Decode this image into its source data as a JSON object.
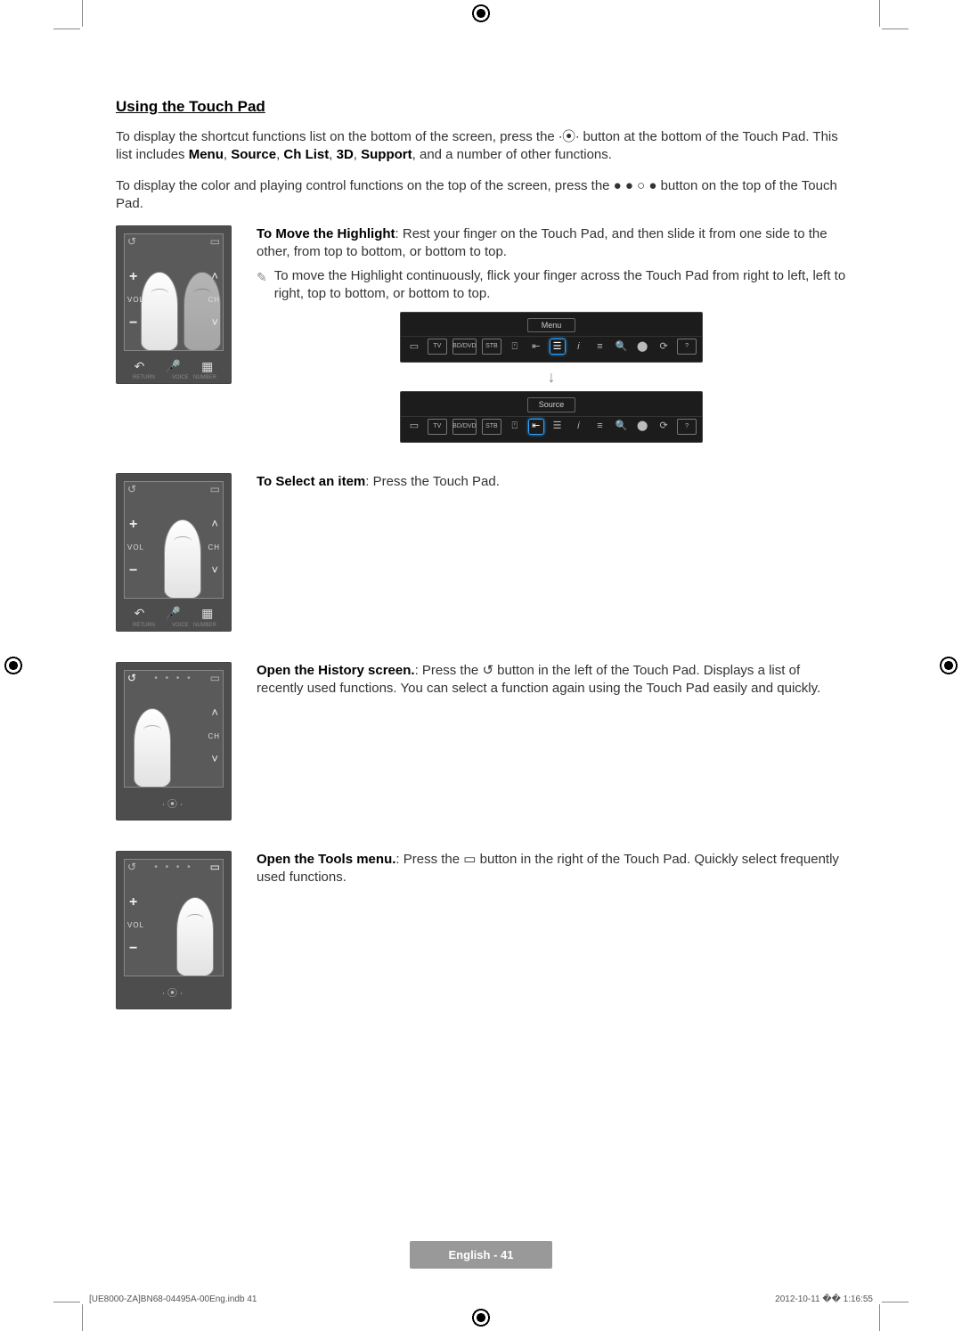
{
  "heading": "Using the Touch Pad",
  "intro1_a": "To display the shortcut functions list on the bottom of the screen, press the ",
  "intro1_b": " button at the bottom of the Touch Pad. This list includes ",
  "intro1_words": {
    "menu": "Menu",
    "source": "Source",
    "chlist": "Ch List",
    "threeD": "3D",
    "support": "Support"
  },
  "intro1_c": ", and a number of other functions.",
  "intro2_a": "To display the color and playing control functions on the top of the screen, press the ",
  "intro2_b": " button on the top of the Touch Pad.",
  "move": {
    "title": "To Move the Highlight",
    "body": ": Rest your finger on the Touch Pad, and then slide it from one side to the other, from top to bottom, or bottom to top.",
    "note": "To move the Highlight continuously, flick your finger across the Touch Pad from right to left, left to right, top to bottom, or bottom to top."
  },
  "menubar": {
    "label": "Menu"
  },
  "sourcebar": {
    "label": "Source"
  },
  "baricons": {
    "tv": "TV",
    "bddvd": "BD/DVD",
    "stb": "STB"
  },
  "select": {
    "title": "To Select an item",
    "body": ": Press the Touch Pad."
  },
  "history": {
    "title": "Open the History screen.",
    "body1": ": Press the ",
    "body2": " button in the left of the Touch Pad. Displays a list of recently used functions. You can select a function again using the Touch Pad easily and quickly."
  },
  "tools": {
    "title": "Open the Tools menu.",
    "body1": ": Press the ",
    "body2": " button in the right of the Touch Pad. Quickly select frequently used functions."
  },
  "touchpad_labels": {
    "vol": "VOL",
    "ch": "CH",
    "return": "RETURN",
    "voice": "VOICE",
    "number": "NUMBER"
  },
  "footer": {
    "lang_page": "English - 41"
  },
  "print": {
    "left": "[UE8000-ZA]BN68-04495A-00Eng.indb   41",
    "right": "2012-10-11   �� 1:16:55"
  }
}
